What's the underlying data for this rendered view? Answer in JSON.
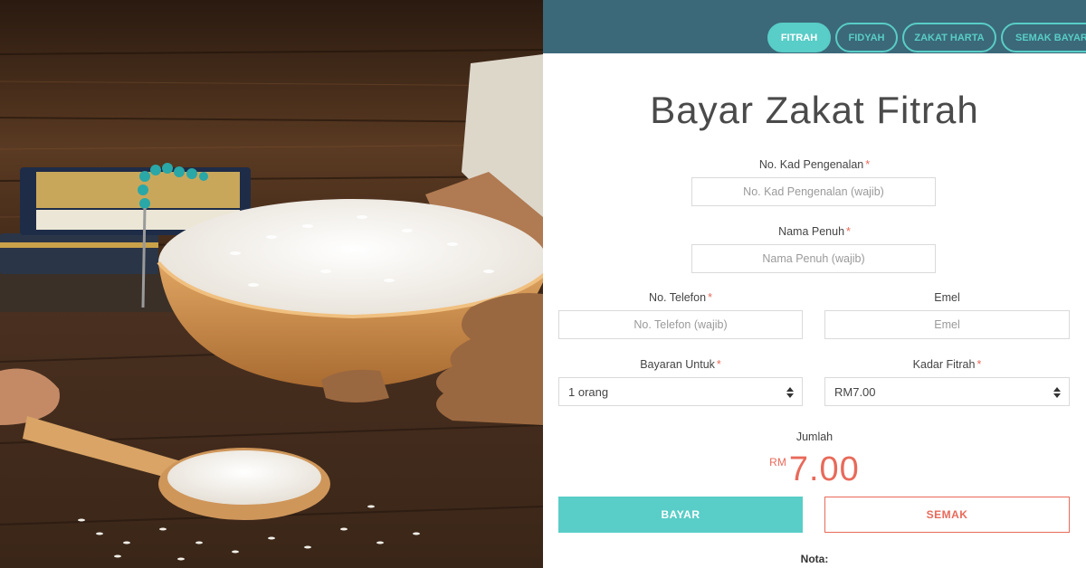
{
  "nav": {
    "tabs": [
      {
        "label": "FITRAH",
        "active": true
      },
      {
        "label": "FIDYAH",
        "active": false
      },
      {
        "label": "ZAKAT HARTA",
        "active": false
      },
      {
        "label": "SEMAK BAYARAN",
        "active": false
      }
    ]
  },
  "form": {
    "title": "Bayar Zakat Fitrah",
    "ic": {
      "label": "No. Kad Pengenalan",
      "required_mark": "*",
      "placeholder": "No. Kad Pengenalan (wajib)",
      "value": ""
    },
    "name": {
      "label": "Nama Penuh",
      "required_mark": "*",
      "placeholder": "Nama Penuh (wajib)",
      "value": ""
    },
    "phone": {
      "label": "No. Telefon",
      "required_mark": "*",
      "placeholder": "No. Telefon (wajib)",
      "value": ""
    },
    "email": {
      "label": "Emel",
      "placeholder": "Emel",
      "value": ""
    },
    "pay_for": {
      "label": "Bayaran Untuk",
      "required_mark": "*",
      "selected": "1 orang"
    },
    "rate": {
      "label": "Kadar Fitrah",
      "required_mark": "*",
      "selected": "RM7.00"
    },
    "total": {
      "label": "Jumlah",
      "currency": "RM",
      "amount": "7.00"
    },
    "pay_button": "BAYAR",
    "check_button": "SEMAK",
    "note_label": "Nota:"
  },
  "colors": {
    "nav_bg": "#3b6979",
    "accent": "#59cdc7",
    "danger": "#e86a5a"
  }
}
